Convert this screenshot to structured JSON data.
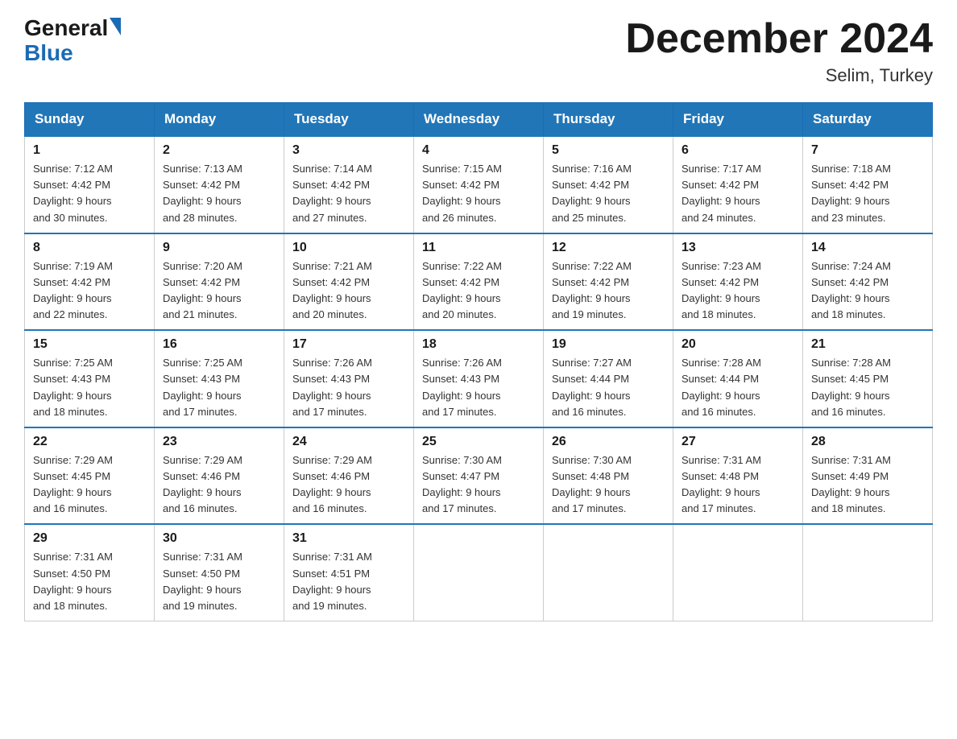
{
  "header": {
    "logo_general": "General",
    "logo_blue": "Blue",
    "month_title": "December 2024",
    "location": "Selim, Turkey"
  },
  "days_of_week": [
    "Sunday",
    "Monday",
    "Tuesday",
    "Wednesday",
    "Thursday",
    "Friday",
    "Saturday"
  ],
  "weeks": [
    [
      {
        "day": "1",
        "sunrise": "7:12 AM",
        "sunset": "4:42 PM",
        "daylight": "9 hours and 30 minutes."
      },
      {
        "day": "2",
        "sunrise": "7:13 AM",
        "sunset": "4:42 PM",
        "daylight": "9 hours and 28 minutes."
      },
      {
        "day": "3",
        "sunrise": "7:14 AM",
        "sunset": "4:42 PM",
        "daylight": "9 hours and 27 minutes."
      },
      {
        "day": "4",
        "sunrise": "7:15 AM",
        "sunset": "4:42 PM",
        "daylight": "9 hours and 26 minutes."
      },
      {
        "day": "5",
        "sunrise": "7:16 AM",
        "sunset": "4:42 PM",
        "daylight": "9 hours and 25 minutes."
      },
      {
        "day": "6",
        "sunrise": "7:17 AM",
        "sunset": "4:42 PM",
        "daylight": "9 hours and 24 minutes."
      },
      {
        "day": "7",
        "sunrise": "7:18 AM",
        "sunset": "4:42 PM",
        "daylight": "9 hours and 23 minutes."
      }
    ],
    [
      {
        "day": "8",
        "sunrise": "7:19 AM",
        "sunset": "4:42 PM",
        "daylight": "9 hours and 22 minutes."
      },
      {
        "day": "9",
        "sunrise": "7:20 AM",
        "sunset": "4:42 PM",
        "daylight": "9 hours and 21 minutes."
      },
      {
        "day": "10",
        "sunrise": "7:21 AM",
        "sunset": "4:42 PM",
        "daylight": "9 hours and 20 minutes."
      },
      {
        "day": "11",
        "sunrise": "7:22 AM",
        "sunset": "4:42 PM",
        "daylight": "9 hours and 20 minutes."
      },
      {
        "day": "12",
        "sunrise": "7:22 AM",
        "sunset": "4:42 PM",
        "daylight": "9 hours and 19 minutes."
      },
      {
        "day": "13",
        "sunrise": "7:23 AM",
        "sunset": "4:42 PM",
        "daylight": "9 hours and 18 minutes."
      },
      {
        "day": "14",
        "sunrise": "7:24 AM",
        "sunset": "4:42 PM",
        "daylight": "9 hours and 18 minutes."
      }
    ],
    [
      {
        "day": "15",
        "sunrise": "7:25 AM",
        "sunset": "4:43 PM",
        "daylight": "9 hours and 18 minutes."
      },
      {
        "day": "16",
        "sunrise": "7:25 AM",
        "sunset": "4:43 PM",
        "daylight": "9 hours and 17 minutes."
      },
      {
        "day": "17",
        "sunrise": "7:26 AM",
        "sunset": "4:43 PM",
        "daylight": "9 hours and 17 minutes."
      },
      {
        "day": "18",
        "sunrise": "7:26 AM",
        "sunset": "4:43 PM",
        "daylight": "9 hours and 17 minutes."
      },
      {
        "day": "19",
        "sunrise": "7:27 AM",
        "sunset": "4:44 PM",
        "daylight": "9 hours and 16 minutes."
      },
      {
        "day": "20",
        "sunrise": "7:28 AM",
        "sunset": "4:44 PM",
        "daylight": "9 hours and 16 minutes."
      },
      {
        "day": "21",
        "sunrise": "7:28 AM",
        "sunset": "4:45 PM",
        "daylight": "9 hours and 16 minutes."
      }
    ],
    [
      {
        "day": "22",
        "sunrise": "7:29 AM",
        "sunset": "4:45 PM",
        "daylight": "9 hours and 16 minutes."
      },
      {
        "day": "23",
        "sunrise": "7:29 AM",
        "sunset": "4:46 PM",
        "daylight": "9 hours and 16 minutes."
      },
      {
        "day": "24",
        "sunrise": "7:29 AM",
        "sunset": "4:46 PM",
        "daylight": "9 hours and 16 minutes."
      },
      {
        "day": "25",
        "sunrise": "7:30 AM",
        "sunset": "4:47 PM",
        "daylight": "9 hours and 17 minutes."
      },
      {
        "day": "26",
        "sunrise": "7:30 AM",
        "sunset": "4:48 PM",
        "daylight": "9 hours and 17 minutes."
      },
      {
        "day": "27",
        "sunrise": "7:31 AM",
        "sunset": "4:48 PM",
        "daylight": "9 hours and 17 minutes."
      },
      {
        "day": "28",
        "sunrise": "7:31 AM",
        "sunset": "4:49 PM",
        "daylight": "9 hours and 18 minutes."
      }
    ],
    [
      {
        "day": "29",
        "sunrise": "7:31 AM",
        "sunset": "4:50 PM",
        "daylight": "9 hours and 18 minutes."
      },
      {
        "day": "30",
        "sunrise": "7:31 AM",
        "sunset": "4:50 PM",
        "daylight": "9 hours and 19 minutes."
      },
      {
        "day": "31",
        "sunrise": "7:31 AM",
        "sunset": "4:51 PM",
        "daylight": "9 hours and 19 minutes."
      },
      null,
      null,
      null,
      null
    ]
  ],
  "labels": {
    "sunrise": "Sunrise: ",
    "sunset": "Sunset: ",
    "daylight": "Daylight: "
  }
}
